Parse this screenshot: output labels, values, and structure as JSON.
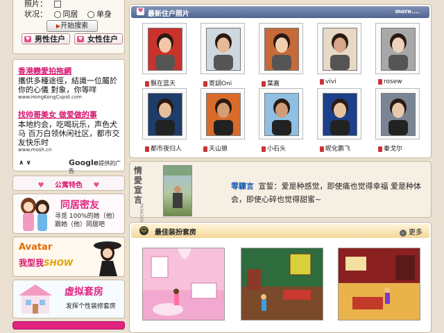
{
  "search": {
    "photo_label": "照片：",
    "status_label": "状况：",
    "status_options": [
      "同居",
      "单身"
    ],
    "start_button": "开始搜索",
    "male_button": "男性住户",
    "female_button": "女性住户"
  },
  "ads": [
    {
      "title": "香港戀愛拍拖網",
      "text": "攜供多種途徑，結識一位屬於你的心儀 對象，你等咩",
      "url": "www.HongKongCupid.com"
    },
    {
      "title": "找帅哥美女 做爱做的事",
      "text": "本地约会，吃喝玩乐，声色犬马 百万白领休闲社区，都市交友快乐时",
      "url": "www.mosh.cn"
    }
  ],
  "ad_nav": "∧ ∨",
  "ad_by": "提供的广告",
  "ad_by_brand": "Google",
  "apartment": {
    "title": "公寓特色",
    "items": [
      {
        "title": "同居密友",
        "desc1": "寻觅 100%的她（他）",
        "desc2": "跟她（他）同居吧"
      },
      {
        "title1": "Avatar",
        "title2": "我型我",
        "title3": "SHOW"
      },
      {
        "title": "虚拟套房",
        "desc1": "发挥个性装修套房"
      }
    ]
  },
  "newest": {
    "title": "最新住户照片",
    "more": "more....",
    "residents": [
      {
        "name": "飘在蓝天"
      },
      {
        "name": "寄翃Oni"
      },
      {
        "name": "葉嘉"
      },
      {
        "name": "vivi"
      },
      {
        "name": "rosew"
      },
      {
        "name": "都市夜归人"
      },
      {
        "name": "天山狼"
      },
      {
        "name": "小石头"
      },
      {
        "name": "昵化鹏飞"
      },
      {
        "name": "秦戈尔"
      }
    ]
  },
  "declaration": {
    "side_label": "情愛宣言",
    "side_small": "PARADISE",
    "user": "零驟言",
    "label": "宣誓：",
    "text1": "爱是种感觉，即使痛也觉得幸福 爱是种体",
    "text2": "会，即使心碎也觉得甜蜜~"
  },
  "rooms": {
    "title": "最佳装扮套房",
    "more": "更多"
  }
}
